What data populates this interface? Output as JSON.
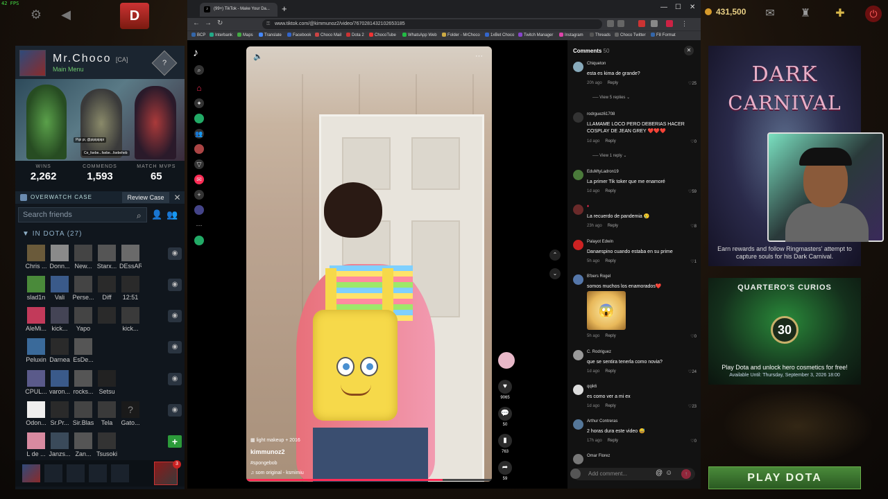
{
  "fps": "42 FPS",
  "dota": {
    "shards": "431,500",
    "profile": {
      "name": "Mr.Choco",
      "tag": "[CA]",
      "status": "Main Menu",
      "rank_symbol": "?"
    },
    "hero_chat": [
      "Pipi pi, @pipipipipi",
      "Ce_fsebe...fsebe...fsebeheb"
    ],
    "stats": [
      {
        "label": "WINS",
        "value": "2,262"
      },
      {
        "label": "COMMENDS",
        "value": "1,593"
      },
      {
        "label": "MATCH MVPS",
        "value": "65"
      }
    ],
    "overwatch": {
      "label": "OVERWATCH CASE",
      "button": "Review Case"
    },
    "search_placeholder": "Search friends",
    "in_dota": "IN DOTA (27)",
    "friends": [
      [
        "Chris ...",
        "Donn...",
        "New...",
        "Starx...",
        "DEssAR"
      ],
      [
        "slad1n",
        "Vali",
        "Perse...",
        "Diff",
        "12:51"
      ],
      [
        "AleMi...",
        "kick...",
        "Yapo",
        "",
        "kick..."
      ],
      [
        "Peluxin",
        "Darnea",
        "EsDe...",
        "",
        ""
      ],
      [
        "CPUL...",
        "varon...",
        "rocks...",
        "Setsu",
        ""
      ],
      [
        "Odon...",
        "Sr.Pr...",
        "Sir.Blas",
        "Tela",
        "Gato..."
      ],
      [
        "L de ...",
        "Janzs...",
        "Zan...",
        "Tsusoki",
        ""
      ]
    ],
    "party_badge": "3",
    "carnival": {
      "title1": "DARK",
      "title2": "CARNIVAL",
      "promo": "Earn rewards and follow Ringmasters' attempt to capture souls for his Dark Carnival."
    },
    "curios": {
      "title": "QUARTERO'S CURIOS",
      "count": "30",
      "promo": "Play Dota and unlock hero cosmetics for free!",
      "date": "Available Until:  Thursday, September 3, 2026 18:00"
    },
    "play_button": "PLAY DOTA"
  },
  "browser": {
    "tab_title": "(99+) TikTok - Make Your Da...",
    "url": "www.tiktok.com/@kimmunoz2/video/7670281432102653185",
    "bookmarks": [
      "BCP",
      "Interbank",
      "Maps",
      "Translate",
      "Facebook",
      "Choco Mail",
      "Dota 2",
      "ChocoTube",
      "WhatsApp Web",
      "Folder - MrChoco",
      "1xBet Choco",
      "Twitch Manager",
      "Instagram",
      "Threads",
      "Choco Twitter",
      "F8 Format"
    ]
  },
  "tiktok": {
    "video": {
      "tag": "light makeup + 2016",
      "user": "kimmunoz2",
      "hashtag": "#spongebob",
      "sound": "som original - ksmimiu",
      "progress": 0.8
    },
    "actions": {
      "likes": "9065",
      "comments": "50",
      "saves": "763",
      "shares": "59"
    },
    "comments_header": "Comments",
    "comments_count": "50",
    "comments": [
      {
        "user": "Chiqueton",
        "text": "esta es kima de grande?",
        "time": "20h ago",
        "reply": "Reply",
        "likes": "25",
        "more": "View 5 replies"
      },
      {
        "user": "rodrguez61708",
        "text": "LLAMAME LOCO PERO DEBERIAS HACER COSPLAY DE JEAN GREY ❤️❤️❤️",
        "time": "1d ago",
        "reply": "Reply",
        "likes": "0",
        "more": "View 1 reply"
      },
      {
        "user": "EduMtyLadron19",
        "text": "La primer Tik toker que me enamoré",
        "time": "1d ago",
        "reply": "Reply",
        "likes": "59",
        "more": ""
      },
      {
        "user": "",
        "text": "La recuerdo de pandemia 🥲",
        "time": "23h ago",
        "reply": "Reply",
        "likes": "8",
        "more": ""
      },
      {
        "user": "Palayot Edwin",
        "text": "Danaespino cuando estaba en su prime",
        "time": "5h ago",
        "reply": "Reply",
        "likes": "1",
        "more": ""
      },
      {
        "user": "B'bers Rogel",
        "text": "somos muchos los enamorados❤️",
        "time": "5h ago",
        "reply": "Reply",
        "likes": "0",
        "more": ""
      },
      {
        "user": "C. Rodriguez",
        "text": "que se sentira tenerla como novia?",
        "time": "1d ago",
        "reply": "Reply",
        "likes": "24",
        "more": ""
      },
      {
        "user": "qqik6",
        "text": "es como ver a mi ex",
        "time": "1d ago",
        "reply": "Reply",
        "likes": "23",
        "more": ""
      },
      {
        "user": "Arthur Contreras",
        "text": "2 horas dura este video 😅",
        "time": "17h ago",
        "reply": "Reply",
        "likes": "0",
        "more": ""
      },
      {
        "user": "Omar Florez",
        "text": "",
        "time": "",
        "reply": "",
        "likes": "",
        "more": ""
      }
    ],
    "comment_placeholder": "Add comment..."
  }
}
